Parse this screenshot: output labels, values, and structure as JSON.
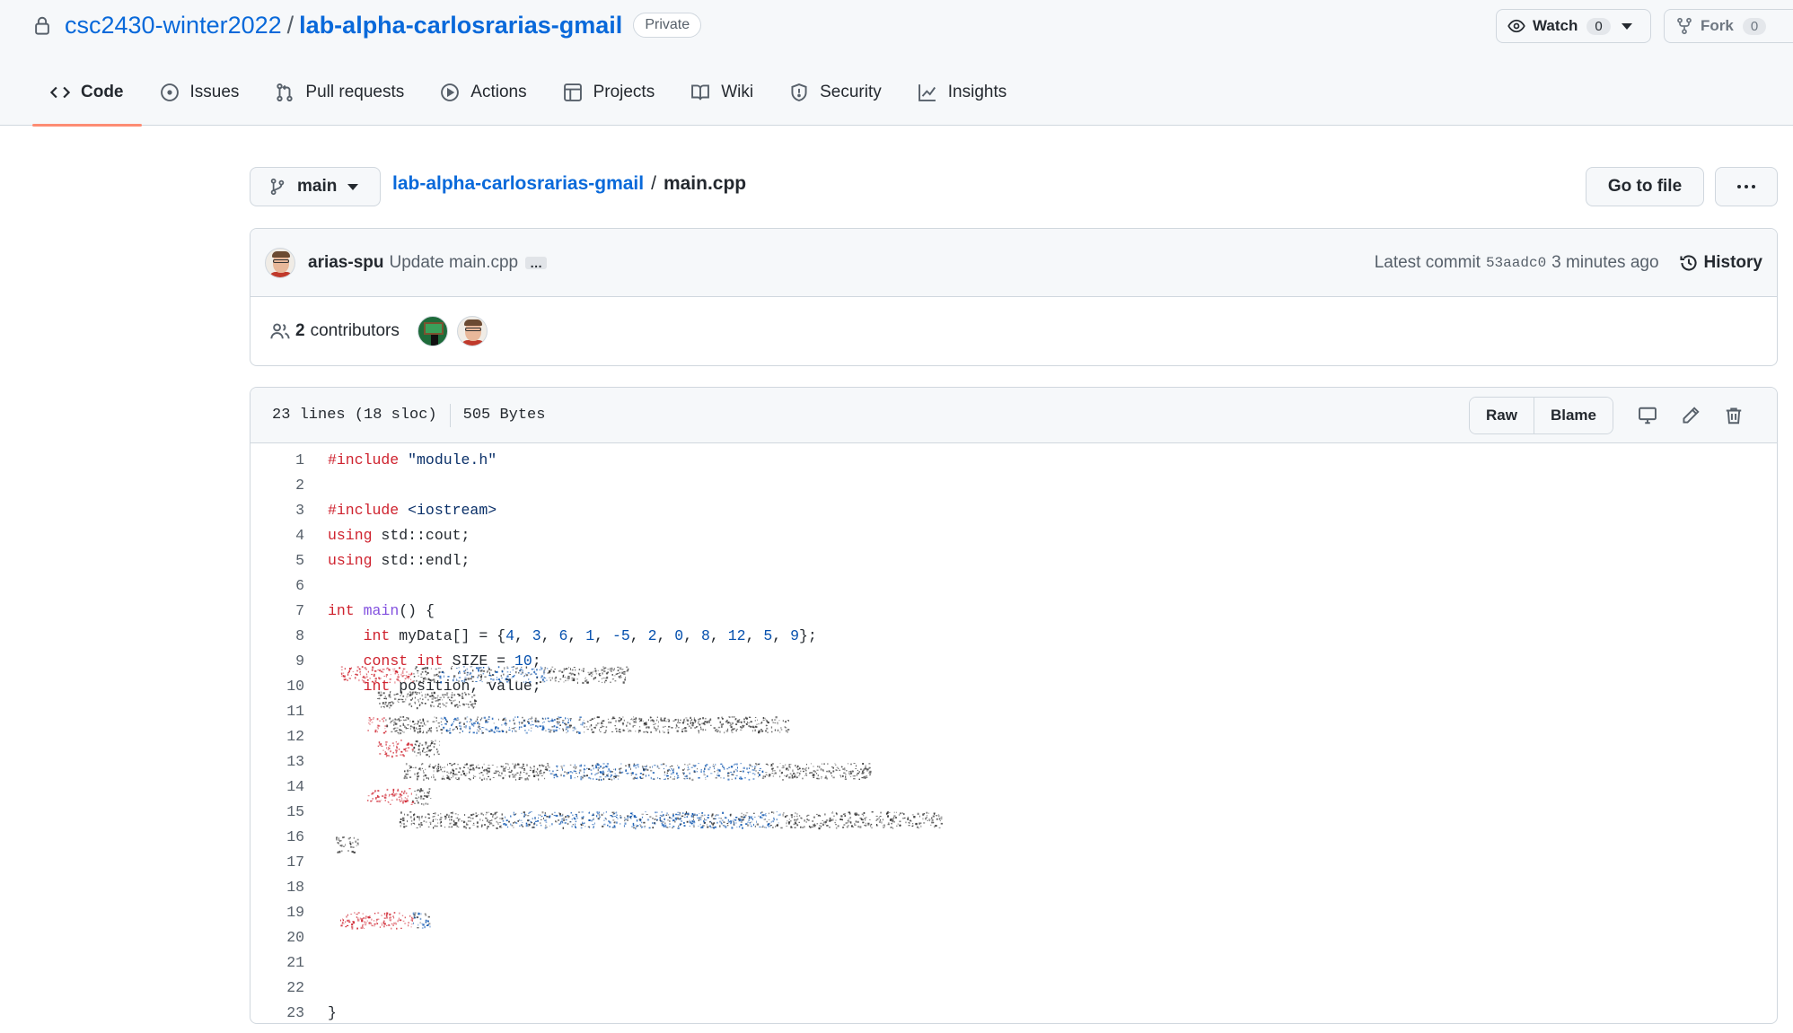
{
  "repo": {
    "owner": "csc2430-winter2022",
    "separator": "/",
    "name": "lab-alpha-carlosrarias-gmail",
    "visibility": "Private"
  },
  "header_buttons": {
    "watch_label": "Watch",
    "watch_count": "0",
    "fork_label": "Fork",
    "fork_count": "0"
  },
  "tabs": [
    {
      "label": "Code",
      "icon": "code-icon",
      "selected": true
    },
    {
      "label": "Issues",
      "icon": "issue-icon"
    },
    {
      "label": "Pull requests",
      "icon": "pull-request-icon"
    },
    {
      "label": "Actions",
      "icon": "play-icon"
    },
    {
      "label": "Projects",
      "icon": "table-icon"
    },
    {
      "label": "Wiki",
      "icon": "book-icon"
    },
    {
      "label": "Security",
      "icon": "shield-icon"
    },
    {
      "label": "Insights",
      "icon": "graph-icon"
    }
  ],
  "file_nav": {
    "branch": "main",
    "breadcrumb_repo": "lab-alpha-carlosrarias-gmail",
    "breadcrumb_sep": "/",
    "file_name": "main.cpp",
    "go_to_file": "Go to file",
    "more": "···"
  },
  "commit": {
    "author": "arias-spu",
    "message": "Update main.cpp",
    "ellipsis": "…",
    "latest_label": "Latest commit",
    "sha": "53aadc0",
    "time": "3 minutes ago",
    "history": "History"
  },
  "contributors": {
    "count": "2",
    "label": "contributors"
  },
  "file_info": {
    "lines": "23 lines (18 sloc)",
    "size": "505 Bytes",
    "raw": "Raw",
    "blame": "Blame"
  },
  "code_lines": [
    {
      "n": "1"
    },
    {
      "n": "2"
    },
    {
      "n": "3"
    },
    {
      "n": "4"
    },
    {
      "n": "5"
    },
    {
      "n": "6"
    },
    {
      "n": "7"
    },
    {
      "n": "8"
    },
    {
      "n": "9"
    },
    {
      "n": "10"
    },
    {
      "n": "11"
    },
    {
      "n": "12"
    },
    {
      "n": "13"
    },
    {
      "n": "14"
    },
    {
      "n": "15"
    },
    {
      "n": "16"
    },
    {
      "n": "17"
    },
    {
      "n": "18"
    },
    {
      "n": "19"
    },
    {
      "n": "20"
    },
    {
      "n": "21"
    },
    {
      "n": "22"
    },
    {
      "n": "23"
    }
  ],
  "code_text": {
    "l1_kw": "#include",
    "l1_str": "\"module.h\"",
    "l3_kw": "#include",
    "l3_str": "<iostream>",
    "l4_kw": "using",
    "l4_rest": "std::cout;",
    "l5_kw": "using",
    "l5_rest": "std::endl;",
    "l7_kw": "int",
    "l7_fn": "main",
    "l7_rest": "() {",
    "l8_kw": "int",
    "l8_rest": "myData[] = {",
    "l8_nums": [
      "4",
      "3",
      "6",
      "1",
      "-5",
      "2",
      "0",
      "8",
      "12",
      "5",
      "9"
    ],
    "l8_end": "};",
    "l9_kw1": "const",
    "l9_kw2": "int",
    "l9_rest": "SIZE = ",
    "l9_num": "10",
    "l9_end": ";",
    "l10_kw": "int",
    "l10_rest": "position, value;",
    "l23": "}"
  },
  "colors": {
    "link": "#0969da",
    "tab_underline": "#fd8c73",
    "keyword": "#cf222e",
    "string": "#0a3069",
    "number": "#0550ae",
    "function": "#8250df"
  }
}
